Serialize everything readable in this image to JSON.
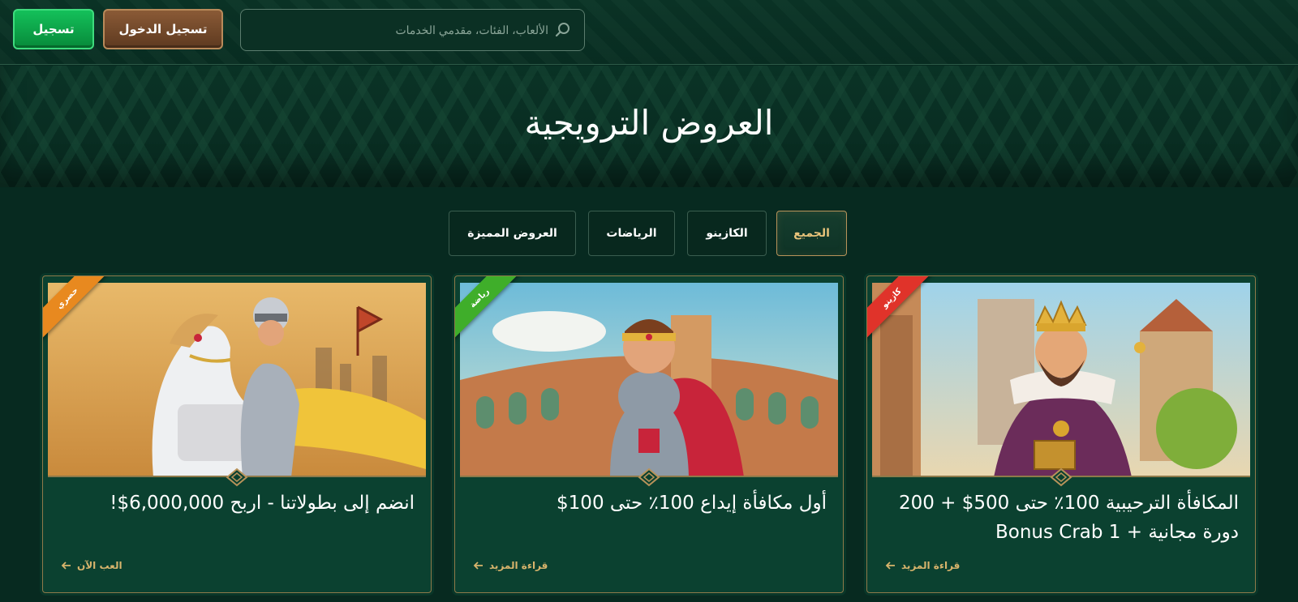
{
  "header": {
    "register_label": "تسجيل",
    "login_label": "تسجيل الدخول",
    "search": {
      "placeholder": "الألعاب، الفئات، مقدمي الخدمات",
      "icon": "search-icon"
    }
  },
  "banner": {
    "title": "العروض الترويجية"
  },
  "tabs": [
    {
      "label": "الجميع",
      "active": true
    },
    {
      "label": "الكازينو",
      "active": false
    },
    {
      "label": "الرياضات",
      "active": false
    },
    {
      "label": "العروض المميزة",
      "active": false
    }
  ],
  "cards": [
    {
      "ribbon": "كازينو",
      "ribbon_color": "#e0332a",
      "title": "المكافأة الترحيبية 100٪ حتى 500$ + 200 دورة مجانية + 1 Bonus Crab",
      "link_label": "قراءة المزيد",
      "image": "king-illustration"
    },
    {
      "ribbon": "رياضة",
      "ribbon_color": "#3fae2a",
      "title": "أول مكافأة إيداع 100٪ حتى 100$",
      "link_label": "قراءة المزيد",
      "image": "gladiator-illustration"
    },
    {
      "ribbon": "حصري",
      "ribbon_color": "#e8891f",
      "title": "انضم إلى بطولاتنا - اربح 6,000,000$!",
      "link_label": "العب الآن",
      "image": "knight-illustration"
    }
  ],
  "colors": {
    "background": "#072a20",
    "accent_gold": "#d8b46c",
    "register_green": "#0fa64a",
    "login_brown": "#7a4e2e"
  }
}
